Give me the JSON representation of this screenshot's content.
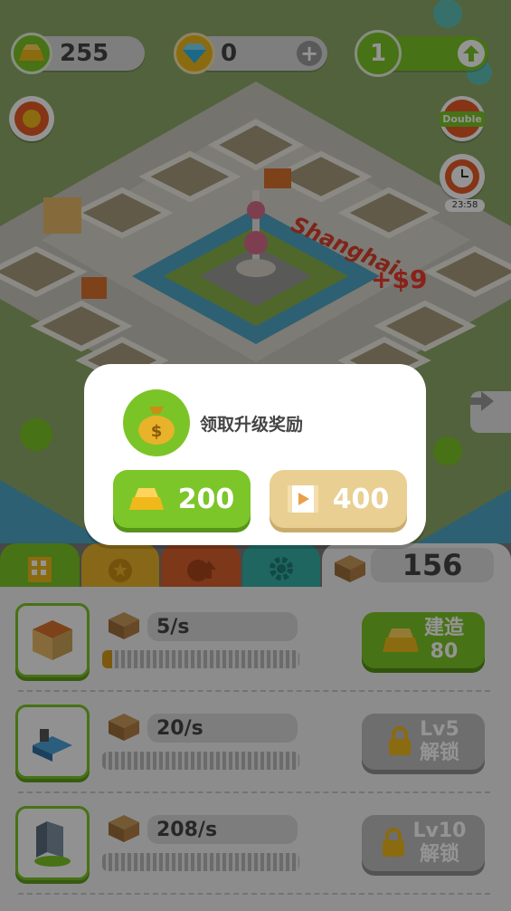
{
  "hud": {
    "gold": "255",
    "diamonds": "0",
    "plus": "+",
    "level": "1",
    "double_label": "Double",
    "timer": "23:58"
  },
  "scene": {
    "city_sign": "Shanghai",
    "income_popup": "+$9"
  },
  "popup": {
    "title": "领取升级奖励",
    "gold_reward": "200",
    "video_reward": "400"
  },
  "tabs": {
    "stock": "156"
  },
  "buildings": [
    {
      "rate": "5/s",
      "progress": 0.05,
      "action_top": "建造",
      "action_bottom": "80",
      "state": "build"
    },
    {
      "rate": "20/s",
      "progress": 0,
      "action_top": "Lv5",
      "action_bottom": "解锁",
      "state": "locked"
    },
    {
      "rate": "208/s",
      "progress": 0,
      "action_top": "Lv10",
      "action_bottom": "解锁",
      "state": "locked"
    }
  ],
  "colors": {
    "accent_green": "#7bc427",
    "gold": "#f0b81a",
    "video_button": "#e9cf92",
    "tab_red": "#d8602c",
    "tab_yellow": "#e8b22a",
    "tab_teal": "#36b0a8"
  }
}
